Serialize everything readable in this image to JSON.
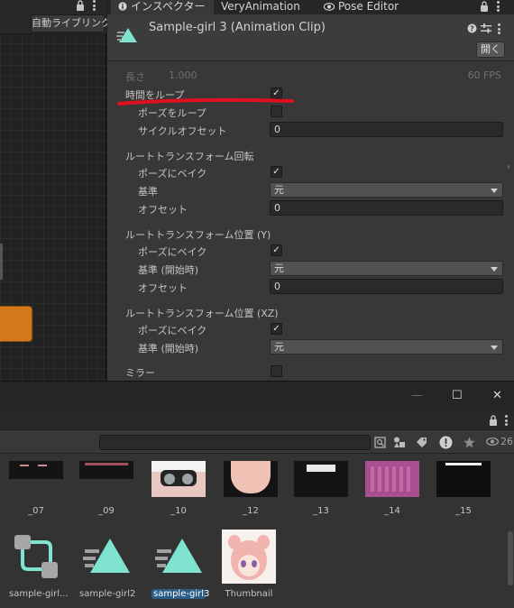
{
  "graph": {
    "auto_live_link": "自動ライブリンク"
  },
  "tabs": [
    {
      "label": "インスペクター",
      "icon": "info-icon"
    },
    {
      "label": "VeryAnimation"
    },
    {
      "label": "Pose Editor",
      "icon": "eye-icon"
    }
  ],
  "inspector": {
    "clip_title": "Sample-girl 3 (Animation Clip)",
    "open_button": "開く",
    "length_label": "長さ",
    "length_value": "1.000",
    "fps": "60 FPS",
    "loop_time": {
      "label": "時間をループ",
      "checked": true
    },
    "loop_pose": {
      "label": "ポーズをループ",
      "checked": false
    },
    "cycle_offset": {
      "label": "サイクルオフセット",
      "value": "0"
    },
    "root_rotation": {
      "title": "ルートトランスフォーム回転",
      "bake": {
        "label": "ポーズにベイク",
        "checked": true
      },
      "base": {
        "label": "基準",
        "value": "元"
      },
      "offset": {
        "label": "オフセット",
        "value": "0"
      }
    },
    "root_position_y": {
      "title": "ルートトランスフォーム位置 (Y)",
      "bake": {
        "label": "ポーズにベイク",
        "checked": true
      },
      "base": {
        "label": "基準 (開始時)",
        "value": "元"
      },
      "offset": {
        "label": "オフセット",
        "value": "0"
      }
    },
    "root_position_xz": {
      "title": "ルートトランスフォーム位置 (XZ)",
      "bake": {
        "label": "ポーズにベイク",
        "checked": true
      },
      "base": {
        "label": "基準 (開始時)",
        "value": "元"
      }
    },
    "mirror": {
      "label": "ミラー",
      "checked": false
    }
  },
  "window": {
    "minimize": "—",
    "maximize": "☐",
    "close": "✕"
  },
  "project": {
    "search_placeholder": "",
    "hidden_count": "26",
    "row1": [
      "_07",
      "_09",
      "_10",
      "_12",
      "_13",
      "_14",
      "_15"
    ],
    "row2": [
      "sample-girl...",
      "sample-girl2",
      "sample-girl3",
      "Thumbnail"
    ],
    "selected": "sample-girl3"
  },
  "colors": {
    "accent_teal": "#7fe3cf",
    "node_orange": "#d27a1a",
    "selection_blue": "#2c5d87",
    "annotation_red": "#e01020"
  }
}
